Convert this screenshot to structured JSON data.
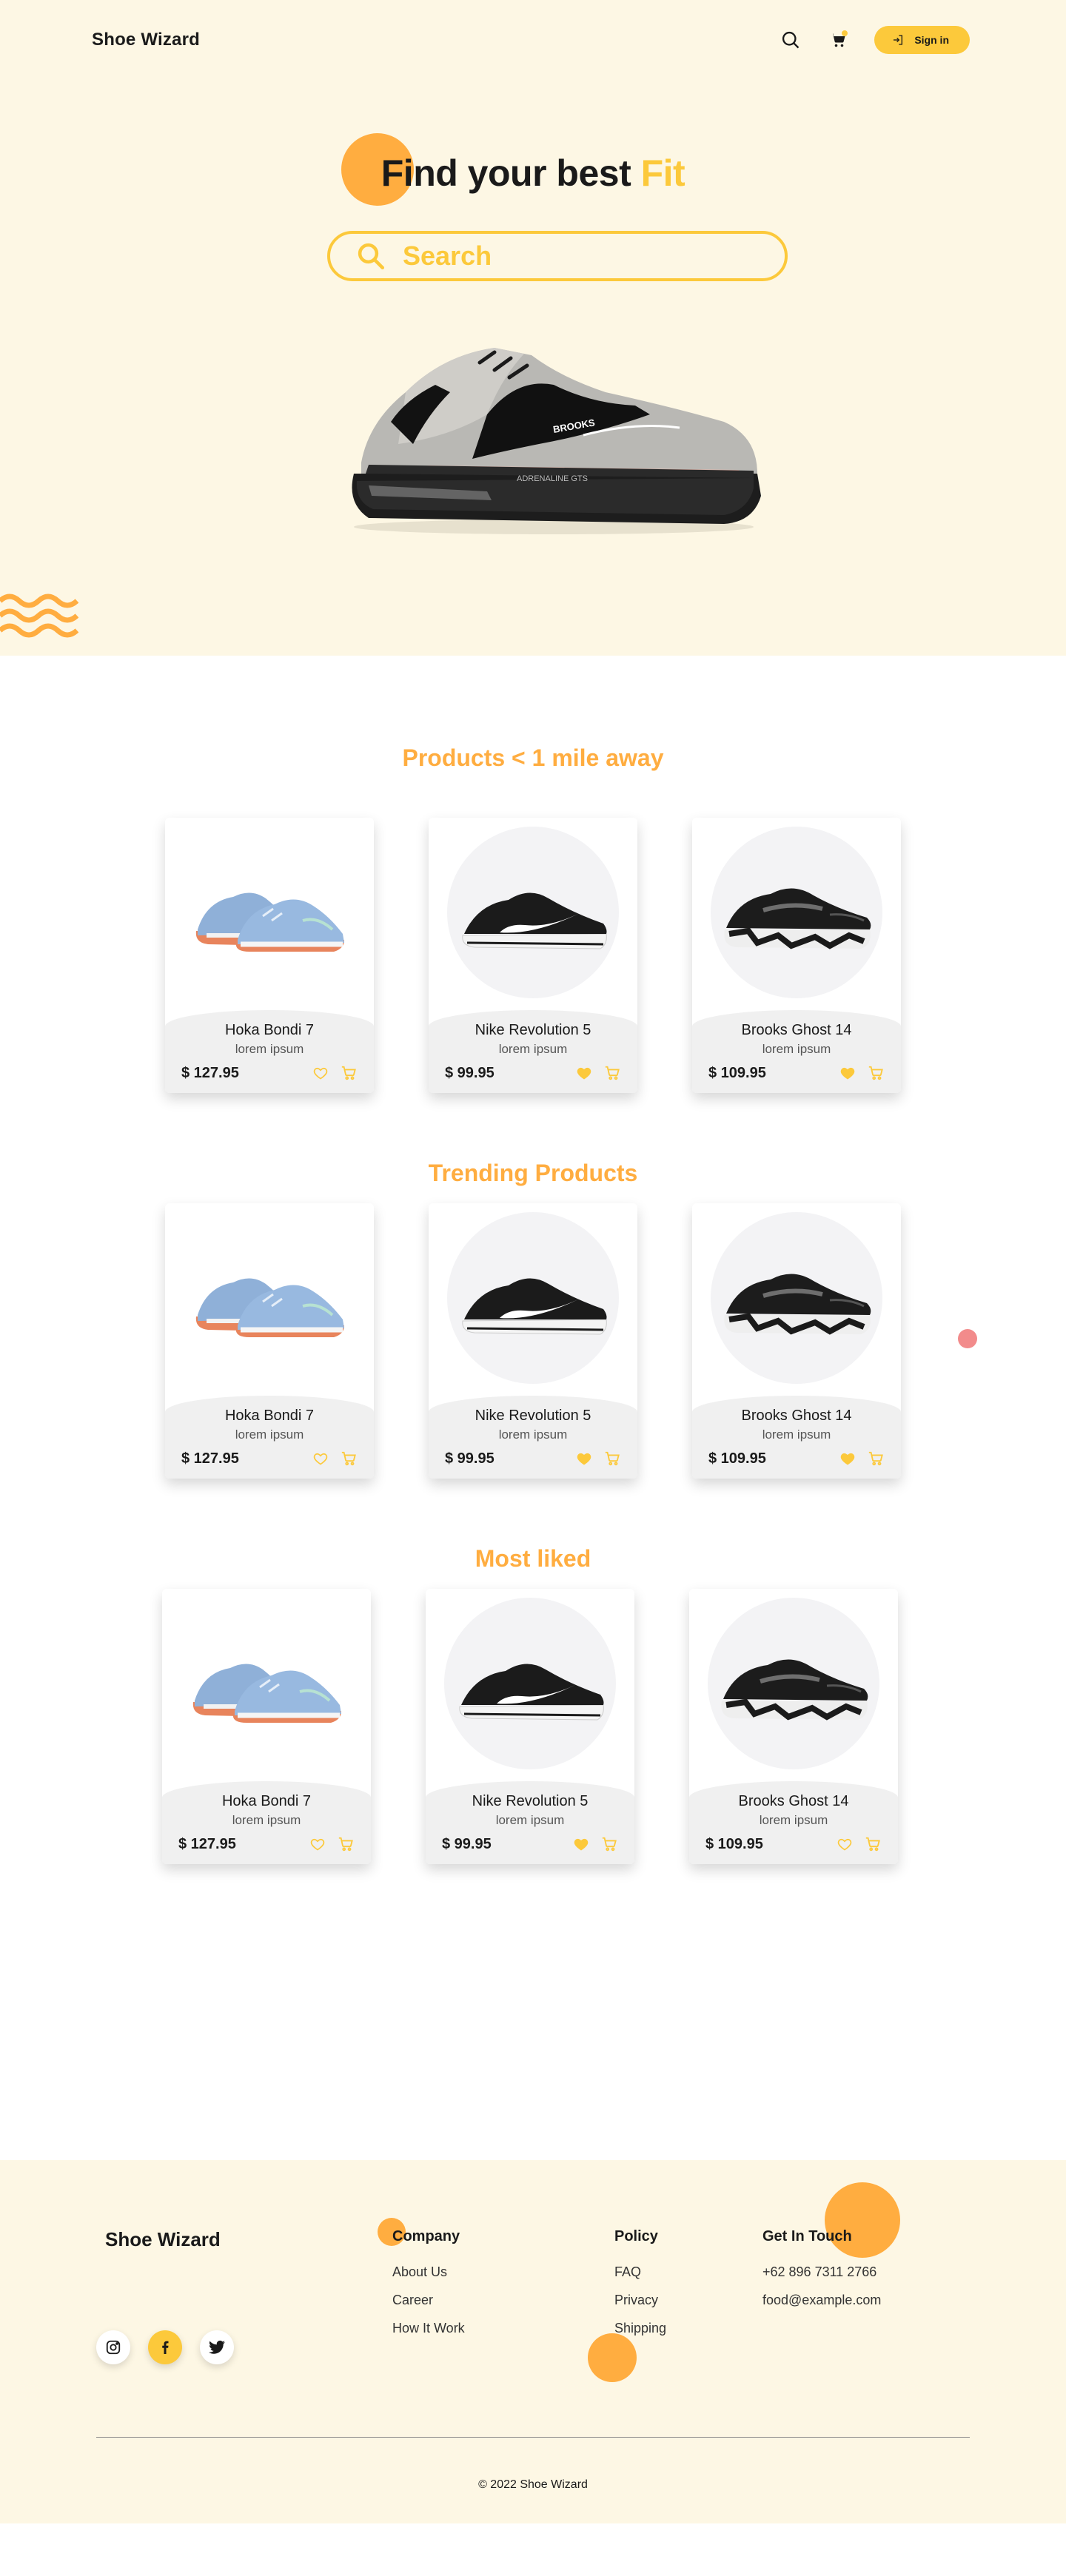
{
  "nav": {
    "brand": "Shoe Wizard",
    "signin_label": "Sign in"
  },
  "hero": {
    "title_main": "Find your best ",
    "title_highlight": "Fit",
    "search_placeholder": "Search"
  },
  "sections": [
    {
      "title": "Products < 1 mile away",
      "products": [
        {
          "name": "Hoka Bondi 7",
          "desc": "lorem ipsum",
          "price": "$ 127.95",
          "liked": false
        },
        {
          "name": "Nike Revolution 5",
          "desc": "lorem ipsum",
          "price": "$ 99.95",
          "liked": true
        },
        {
          "name": "Brooks Ghost 14",
          "desc": "lorem ipsum",
          "price": "$ 109.95",
          "liked": true
        }
      ]
    },
    {
      "title": "Trending Products",
      "products": [
        {
          "name": "Hoka Bondi 7",
          "desc": "lorem ipsum",
          "price": "$ 127.95",
          "liked": false
        },
        {
          "name": "Nike Revolution 5",
          "desc": "lorem ipsum",
          "price": "$ 99.95",
          "liked": true
        },
        {
          "name": "Brooks Ghost 14",
          "desc": "lorem ipsum",
          "price": "$ 109.95",
          "liked": true
        }
      ]
    },
    {
      "title": "Most liked",
      "products": [
        {
          "name": "Hoka Bondi 7",
          "desc": "lorem ipsum",
          "price": "$ 127.95",
          "liked": false
        },
        {
          "name": "Nike Revolution 5",
          "desc": "lorem ipsum",
          "price": "$ 99.95",
          "liked": true
        },
        {
          "name": "Brooks Ghost 14",
          "desc": "lorem ipsum",
          "price": "$ 109.95",
          "liked": false
        }
      ]
    }
  ],
  "footer": {
    "brand": "Shoe Wizard",
    "company": {
      "title": "Company",
      "links": [
        "About Us",
        "Career",
        "How It Work"
      ]
    },
    "policy": {
      "title": "Policy",
      "links": [
        "FAQ",
        "Privacy",
        "Shipping"
      ]
    },
    "contact": {
      "title": "Get In Touch",
      "phone": "+62 896 7311 2766",
      "email": "food@example.com"
    },
    "socials": [
      "instagram-icon",
      "facebook-icon",
      "twitter-icon"
    ],
    "copyright": "© 2022 Shoe Wizard"
  },
  "colors": {
    "accent": "#fcc93b",
    "orange": "#ffad40",
    "cream": "#fdf7e4",
    "dot": "#f28b8b"
  }
}
